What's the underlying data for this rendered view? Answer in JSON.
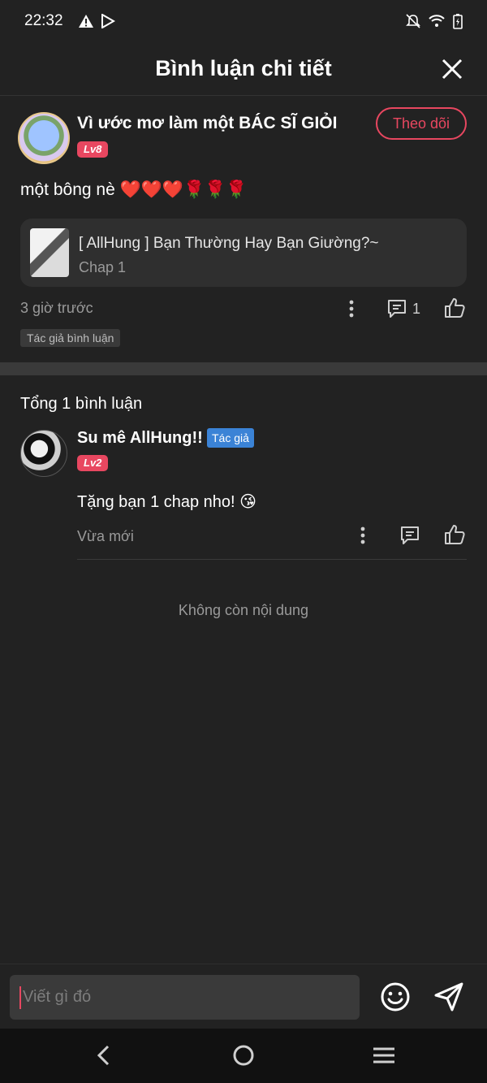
{
  "status_bar": {
    "time": "22:32"
  },
  "header": {
    "title": "Bình luận chi tiết"
  },
  "main_comment": {
    "username": "Vì ước mơ làm một BÁC SĨ GIỎI",
    "level": "Lv8",
    "follow_label": "Theo dõi",
    "text": "một bông nè ❤️❤️❤️🌹🌹🌹",
    "chapter": {
      "title": "[ AllHung ] Bạn Thường Hay Bạn Giường?~",
      "subtitle": "Chap 1"
    },
    "time": "3 giờ trước",
    "reply_count": "1",
    "author_tag": "Tác giả bình luận"
  },
  "replies_section": {
    "total_label": "Tổng 1 bình luận",
    "replies": [
      {
        "username": "Su mê AllHung!!",
        "author_badge": "Tác giả",
        "level": "Lv2",
        "text": "Tặng bạn 1 chap nho! 😘",
        "time": "Vừa mới"
      }
    ],
    "end_label": "Không còn nội dung"
  },
  "input": {
    "placeholder": "Viết gì đó"
  },
  "colors": {
    "accent": "#e84760",
    "author_badge": "#3b83d6",
    "background": "#222222"
  },
  "icons": {
    "status_left": [
      "warning-icon",
      "play-store-icon"
    ],
    "status_right": [
      "bell-off-icon",
      "wifi-icon",
      "battery-icon"
    ],
    "actions": [
      "more-icon",
      "comment-icon",
      "thumbs-up-icon"
    ],
    "input": [
      "emoji-icon",
      "send-icon"
    ],
    "nav": [
      "back-icon",
      "home-icon",
      "menu-icon"
    ]
  }
}
